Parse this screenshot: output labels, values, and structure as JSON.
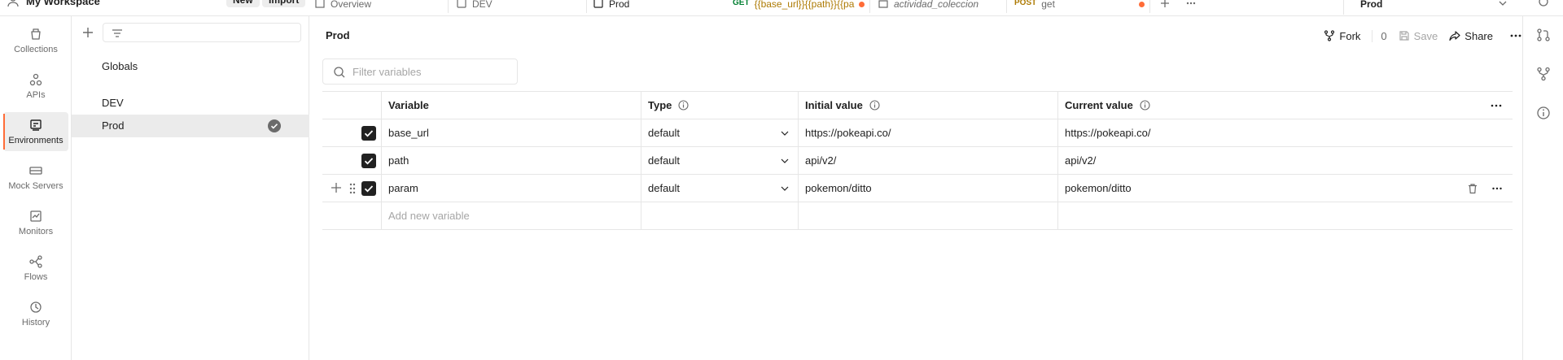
{
  "topbar": {
    "workspace_name": "My Workspace",
    "new_label": "New",
    "import_label": "Import",
    "tabs": [
      {
        "label": "Overview"
      },
      {
        "label": "DEV"
      },
      {
        "label": "Prod"
      },
      {
        "method": "GET",
        "label": "{{base_url}}{{path}}{{pa"
      },
      {
        "label": "actividad_coleccion"
      },
      {
        "method": "POST",
        "label": "get"
      }
    ],
    "environment_selected": "Prod"
  },
  "rail": {
    "items": [
      {
        "label": "Collections"
      },
      {
        "label": "APIs"
      },
      {
        "label": "Environments"
      },
      {
        "label": "Mock Servers"
      },
      {
        "label": "Monitors"
      },
      {
        "label": "Flows"
      },
      {
        "label": "History"
      }
    ]
  },
  "envlist": {
    "items": [
      {
        "label": "Globals"
      },
      {
        "label": "DEV"
      },
      {
        "label": "Prod"
      }
    ]
  },
  "main": {
    "title": "Prod",
    "fork_label": "Fork",
    "fork_count": "0",
    "save_label": "Save",
    "share_label": "Share",
    "filter_placeholder": "Filter variables",
    "columns": {
      "variable": "Variable",
      "type": "Type",
      "initial": "Initial value",
      "current": "Current value"
    },
    "rows": [
      {
        "variable": "base_url",
        "type": "default",
        "initial": "https://pokeapi.co/",
        "current": "https://pokeapi.co/"
      },
      {
        "variable": "path",
        "type": "default",
        "initial": "api/v2/",
        "current": "api/v2/"
      },
      {
        "variable": "param",
        "type": "default",
        "initial": "pokemon/ditto",
        "current": "pokemon/ditto"
      }
    ],
    "add_placeholder": "Add new variable"
  },
  "colors": {
    "accent": "#ff6c37",
    "get": "#007f31",
    "post": "#ad7a03"
  }
}
